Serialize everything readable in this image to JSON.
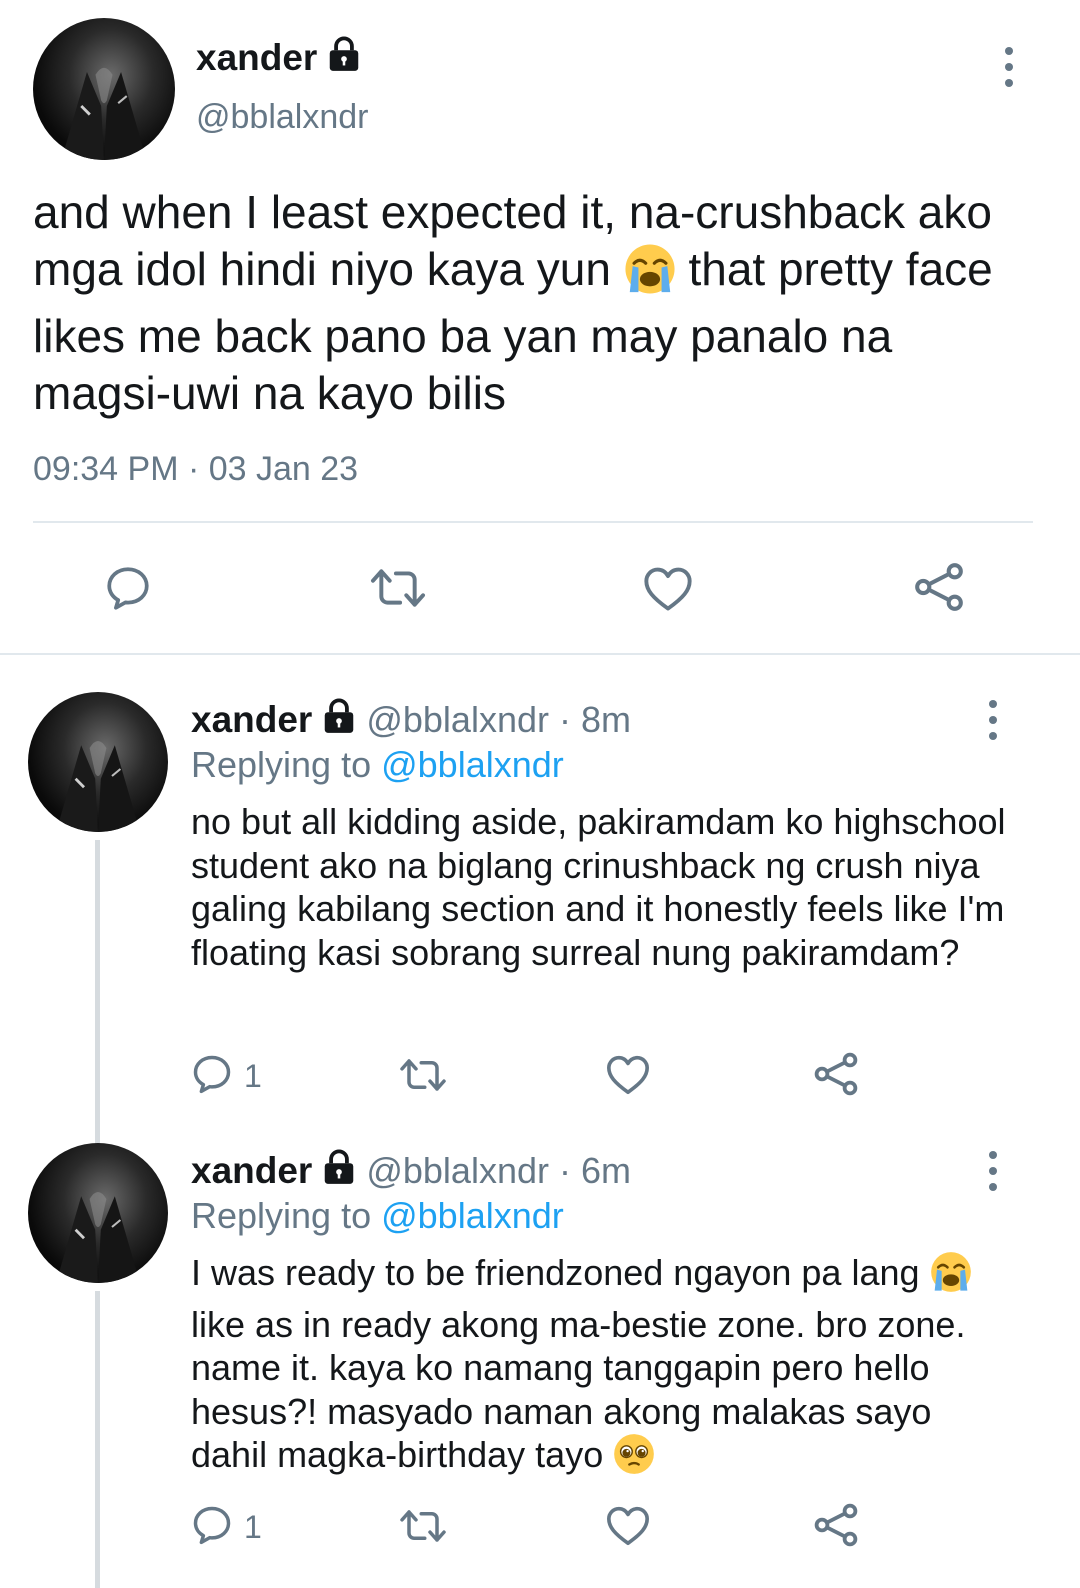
{
  "main_tweet": {
    "name": "xander",
    "handle": "@bblalxndr",
    "text_parts": [
      "and when I least expected it, na-crushback ako mga idol hindi niyo kaya yun ",
      " that pretty face likes me back pano ba yan may panalo na magsi-uwi na kayo bilis"
    ],
    "timestamp": "09:34 PM · 03 Jan 23",
    "icons": {
      "lock": "lock-icon",
      "more": "more-vertical-icon",
      "reply": "reply-icon",
      "retweet": "retweet-icon",
      "like": "heart-icon",
      "share": "share-icon",
      "emoji": "loudly-crying-face-emoji"
    }
  },
  "replies": [
    {
      "name": "xander",
      "handle_time": "@bblalxndr · 8m",
      "replying_label": "Replying to ",
      "replying_to": "@bblalxndr",
      "text_parts": [
        "no but all kidding aside, pakiramdam ko highschool student ako na biglang crinushback ng crush niya galing kabilang section and it honestly feels like I'm floating kasi sobrang surreal nung pakiramdam?"
      ],
      "reply_count": "1"
    },
    {
      "name": "xander",
      "handle_time": "@bblalxndr · 6m",
      "replying_label": "Replying to ",
      "replying_to": "@bblalxndr",
      "text_parts": [
        "I was ready to be friendzoned ngayon pa lang ",
        " like as in ready akong ma-bestie zone. bro zone. name it. kaya ko namang tanggapin pero hello hesus?! masyado naman akong malakas sayo dahil magka-birthday tayo ",
        ""
      ],
      "reply_count": "1"
    }
  ],
  "colors": {
    "text": "#14171a",
    "secondary": "#657786",
    "link": "#1da1f2",
    "divider": "#e1e8ed"
  }
}
